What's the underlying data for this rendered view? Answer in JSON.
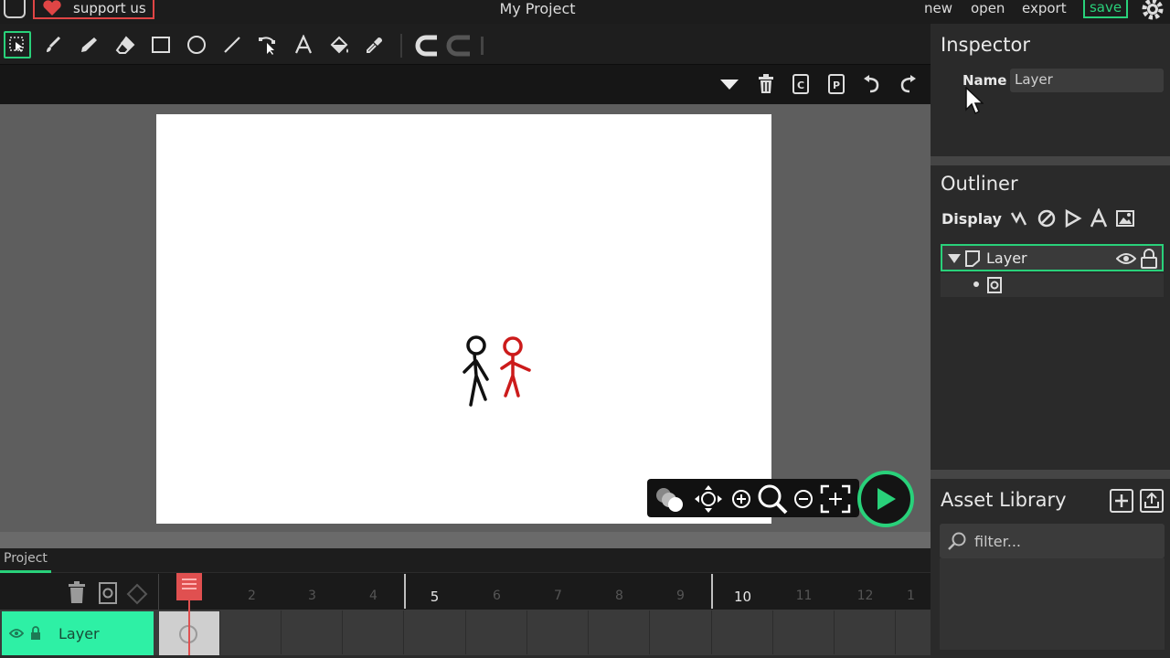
{
  "topbar": {
    "support_label": "support us",
    "project_title": "My Project",
    "menu": [
      "new",
      "open",
      "export"
    ],
    "save_label": "save"
  },
  "toolbar": {
    "tools": [
      "select-tool-icon",
      "brush-icon",
      "pencil-icon",
      "eraser-icon",
      "rectangle-icon",
      "ellipse-icon",
      "line-icon",
      "path-edit-icon",
      "text-tool-icon",
      "fill-bucket-icon",
      "eyedropper-icon"
    ],
    "active_tool": "select-tool-icon"
  },
  "actionbar": {
    "actions": [
      "dropdown-arrow-icon",
      "delete-icon",
      "copy-icon",
      "paste-icon",
      "undo-icon",
      "redo-icon"
    ]
  },
  "inspector": {
    "title": "Inspector",
    "name_label": "Name",
    "name_value": "Layer"
  },
  "outliner": {
    "title": "Outliner",
    "display_label": "Display",
    "layer_name": "Layer"
  },
  "asset_library": {
    "title": "Asset Library",
    "filter_placeholder": "filter..."
  },
  "timeline": {
    "tab_label": "Project",
    "frame_numbers": [
      "2",
      "3",
      "4",
      "5",
      "6",
      "7",
      "8",
      "9",
      "10",
      "11",
      "12",
      "1"
    ],
    "major_frames": [
      "5",
      "10"
    ],
    "layer_name": "Layer",
    "current_frame": 1
  },
  "colors": {
    "accent": "#29d17a",
    "layer_active": "#2ef0a5",
    "playhead": "#e05050",
    "support_border": "#e04545"
  }
}
